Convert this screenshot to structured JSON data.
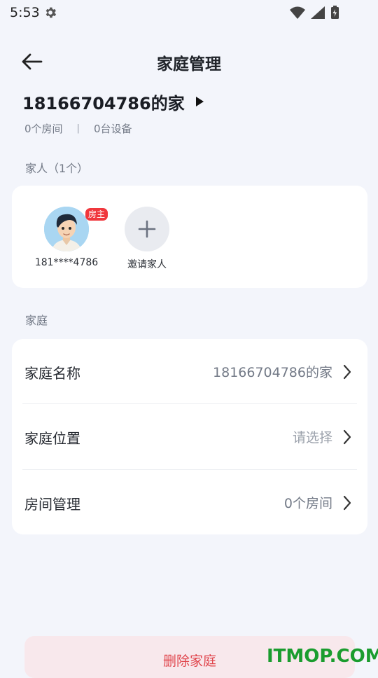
{
  "status_bar": {
    "time": "5:53"
  },
  "header": {
    "title": "家庭管理"
  },
  "home": {
    "name": "18166704786的家",
    "room_count": "0个房间",
    "separator": "|",
    "device_count": "0台设备"
  },
  "members_section": {
    "label": "家人（1个）",
    "members": [
      {
        "name": "181****4786",
        "badge": "房主"
      }
    ],
    "invite_label": "邀请家人"
  },
  "family_section": {
    "label": "家庭",
    "rows": [
      {
        "label": "家庭名称",
        "value": "18166704786的家"
      },
      {
        "label": "家庭位置",
        "value": "请选择"
      },
      {
        "label": "房间管理",
        "value": "0个房间"
      }
    ]
  },
  "delete_button": {
    "label": "删除家庭"
  },
  "watermark": {
    "text": "ITMOP.COM"
  },
  "colors": {
    "background": "#f3f5fb",
    "card": "#ffffff",
    "badge": "#f0373d",
    "delete_bg": "#f8e8ec",
    "delete_text": "#e0454c",
    "watermark": "#1a9c2e"
  }
}
